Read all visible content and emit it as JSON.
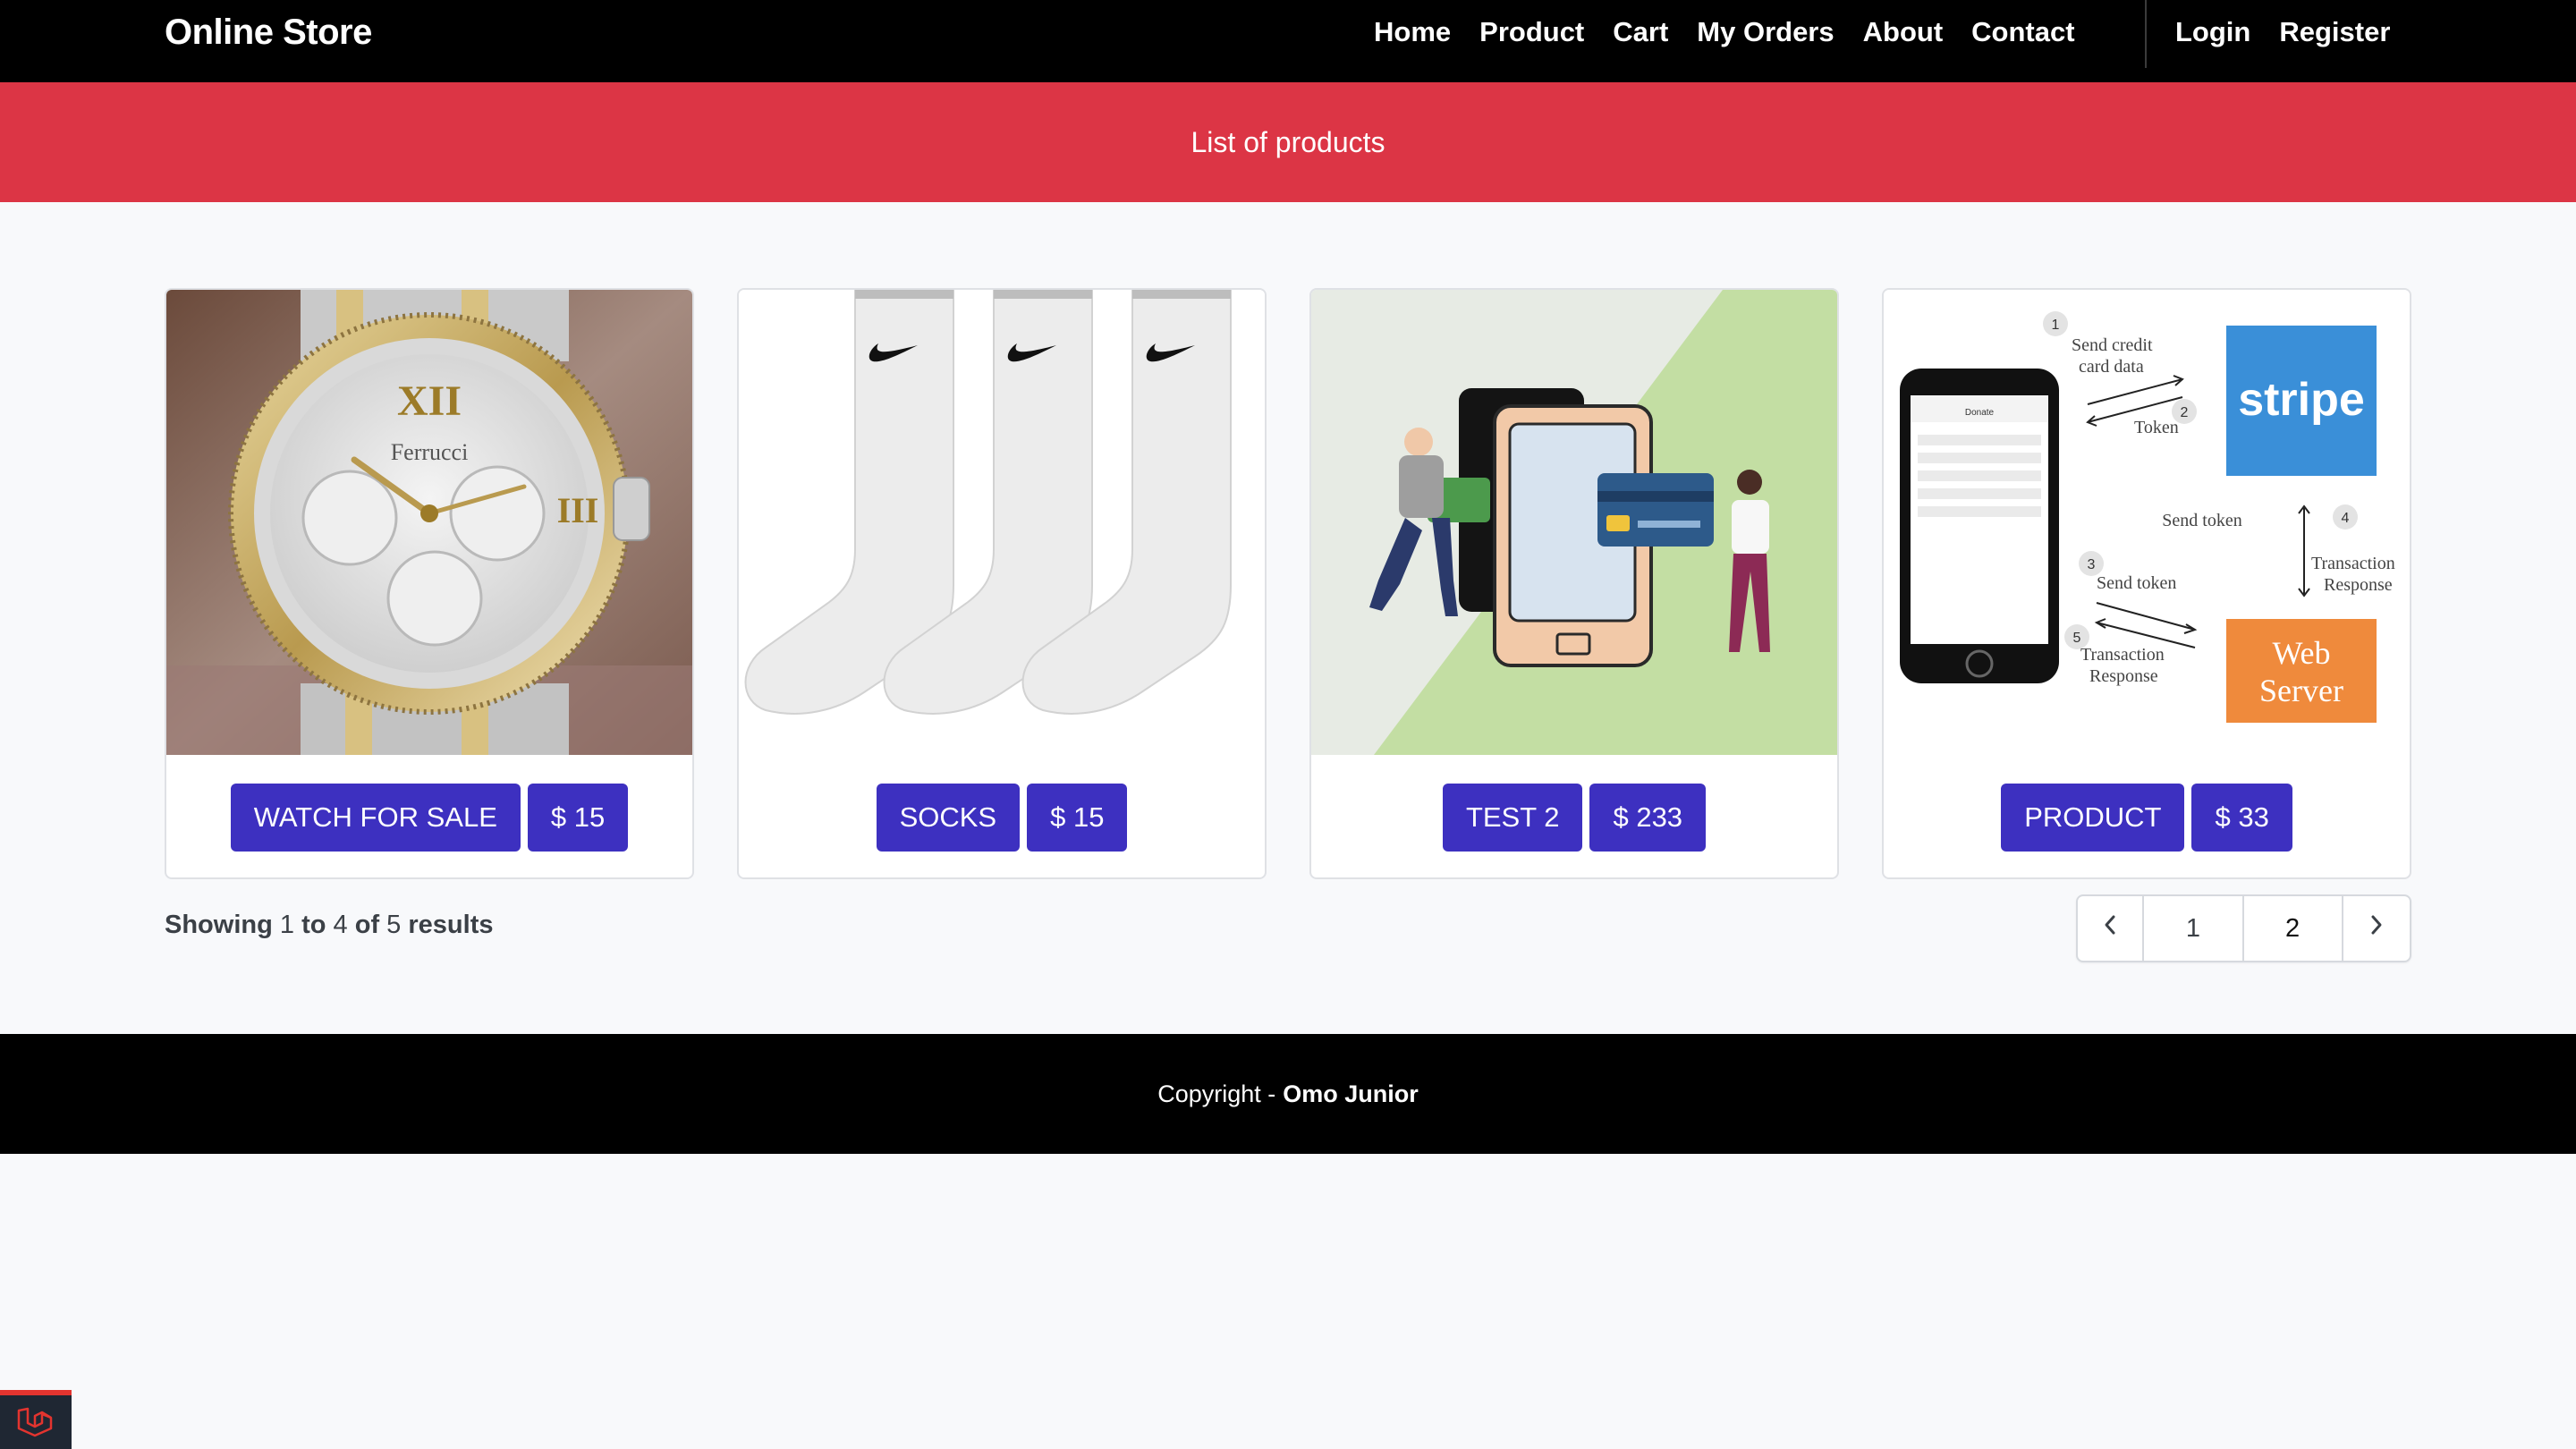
{
  "navbar": {
    "brand": "Online Store",
    "links": [
      "Home",
      "Product",
      "Cart",
      "My Orders",
      "About",
      "Contact"
    ],
    "auth": [
      "Login",
      "Register"
    ]
  },
  "header": {
    "title": "List of products"
  },
  "products": [
    {
      "name": "WATCH FOR SALE",
      "price": "$ 15",
      "image": "wristwatch"
    },
    {
      "name": "SOCKS",
      "price": "$ 15",
      "image": "white-socks"
    },
    {
      "name": "TEST 2",
      "price": "$ 233",
      "image": "mobile-payment-illustration"
    },
    {
      "name": "PRODUCT",
      "price": "$ 33",
      "image": "stripe-payment-flow-diagram"
    }
  ],
  "diagram": {
    "steps": [
      "1",
      "2",
      "3",
      "4",
      "5"
    ],
    "send_credit_1": "Send credit",
    "send_credit_2": "card data",
    "token": "Token",
    "send_token": "Send token",
    "transaction": "Transaction",
    "response": "Response",
    "stripe": "stripe",
    "web": "Web",
    "server": "Server",
    "phone_header": "Donate",
    "watch_brand": "Ferrucci"
  },
  "pagination": {
    "summary_prefix": "Showing",
    "from": "1",
    "to_word": "to",
    "to": "4",
    "of_word": "of",
    "total": "5",
    "suffix": "results",
    "pages": [
      "1",
      "2"
    ],
    "prev": "‹",
    "next": "›"
  },
  "footer": {
    "copyright_prefix": "Copyright -",
    "author": "Omo Junior"
  },
  "colors": {
    "navbar": "#000000",
    "band": "#dc3545",
    "button": "#3d30c0",
    "stripe": "#3a8fd8",
    "webserver": "#ef8a3c"
  }
}
